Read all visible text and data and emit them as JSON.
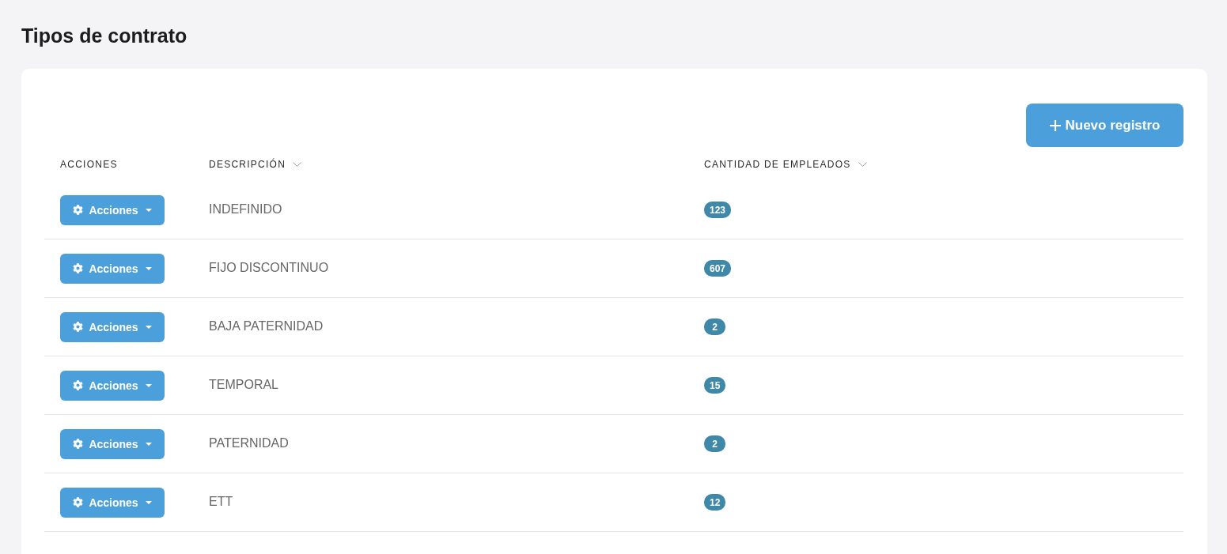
{
  "page": {
    "title": "Tipos de contrato"
  },
  "toolbar": {
    "new_button": {
      "label": "Nuevo registro"
    }
  },
  "table": {
    "columns": [
      {
        "label": "ACCIONES",
        "sortable": false
      },
      {
        "label": "DESCRIPCIÓN",
        "sortable": true
      },
      {
        "label": "CANTIDAD DE EMPLEADOS",
        "sortable": true
      }
    ],
    "rows": [
      {
        "action": "Acciones",
        "description": "INDEFINIDO",
        "count": "123"
      },
      {
        "action": "Acciones",
        "description": "FIJO DISCONTINUO",
        "count": "607"
      },
      {
        "action": "Acciones",
        "description": "BAJA PATERNIDAD",
        "count": "2"
      },
      {
        "action": "Acciones",
        "description": "TEMPORAL",
        "count": "15"
      },
      {
        "action": "Acciones",
        "description": "PATERNIDAD",
        "count": "2"
      },
      {
        "action": "Acciones",
        "description": "ETT",
        "count": "12"
      }
    ]
  }
}
